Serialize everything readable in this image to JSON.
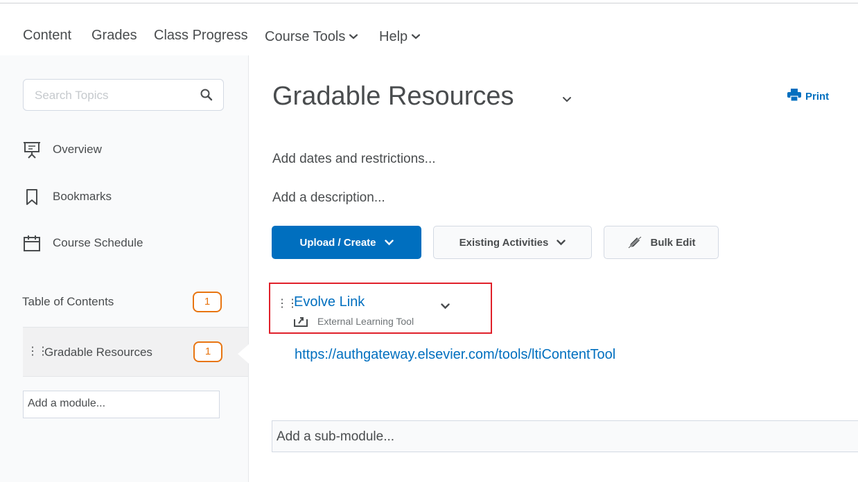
{
  "nav": {
    "items": [
      {
        "label": "Content"
      },
      {
        "label": "Grades"
      },
      {
        "label": "Class Progress"
      },
      {
        "label": "Course Tools"
      },
      {
        "label": "Help"
      }
    ]
  },
  "sidebar": {
    "search": {
      "placeholder": "Search Topics"
    },
    "links": [
      {
        "label": "Overview",
        "icon": "presentation-icon"
      },
      {
        "label": "Bookmarks",
        "icon": "bookmark-icon"
      },
      {
        "label": "Course Schedule",
        "icon": "calendar-icon"
      }
    ],
    "toc": {
      "label": "Table of Contents",
      "count": "1"
    },
    "module": {
      "label": "Gradable Resources",
      "count": "1"
    },
    "add_module": "Add a module..."
  },
  "main": {
    "title": "Gradable Resources",
    "print_label": "Print",
    "add_dates": "Add dates and restrictions...",
    "add_description": "Add a description...",
    "buttons": {
      "upload": "Upload / Create",
      "existing": "Existing Activities",
      "bulk_edit": "Bulk Edit"
    },
    "item": {
      "title": "Evolve Link",
      "type": "External Learning Tool",
      "url": "https://authgateway.elsevier.com/tools/ltiContentTool"
    },
    "add_submodule": "Add a sub-module..."
  },
  "colors": {
    "accent": "#006fbf",
    "badge": "#e87511",
    "highlight": "#e0202a",
    "text": "#494c4e"
  }
}
